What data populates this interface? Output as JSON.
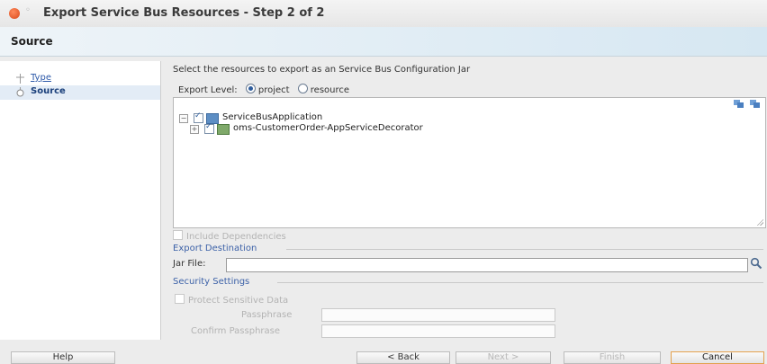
{
  "window": {
    "title": "Export Service Bus Resources - Step 2 of 2"
  },
  "header": {
    "title": "Source"
  },
  "nav": {
    "items": [
      {
        "label": "Type"
      },
      {
        "label": "Source"
      }
    ]
  },
  "content": {
    "instruction": "Select the resources to export as an Service Bus Configuration Jar",
    "export_level": {
      "label": "Export Level:",
      "options": [
        "project",
        "resource"
      ],
      "selected": "project"
    },
    "tree": [
      {
        "label": "ServiceBusApplication",
        "checked": true
      },
      {
        "label": "oms-CustomerOrder-AppServiceDecorator",
        "checked": true
      }
    ],
    "include_dependencies": {
      "label": "Include Dependencies",
      "checked": false
    },
    "export_destination": {
      "title": "Export Destination",
      "jar_label": "Jar File:",
      "jar_value": ""
    },
    "security": {
      "title": "Security Settings",
      "protect_label": "Protect Sensitive Data",
      "passphrase_label": "Passphrase",
      "confirm_label": "Confirm Passphrase"
    }
  },
  "buttons": {
    "help": "Help",
    "back": "< Back",
    "next": "Next >",
    "finish": "Finish",
    "cancel": "Cancel"
  },
  "icons": {
    "close": "close-icon",
    "search": "search-icon",
    "expand_all": "expand-all-icon",
    "collapse_all": "collapse-all-icon"
  }
}
